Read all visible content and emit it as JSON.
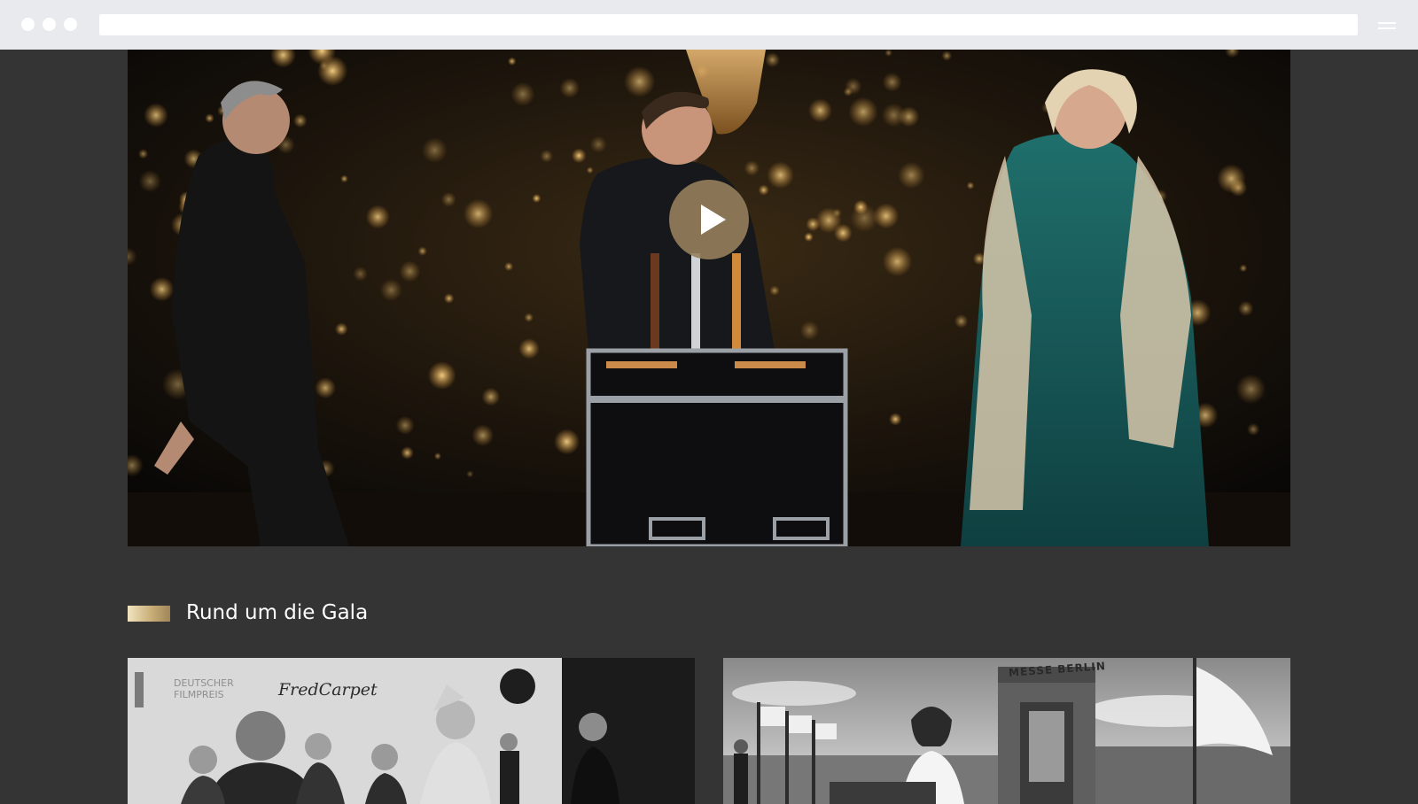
{
  "browser": {
    "window_controls": [
      "close-dot",
      "minimize-dot",
      "maximize-dot"
    ],
    "menu_icon": "hamburger-menu-icon"
  },
  "hero": {
    "play_icon": "play-icon",
    "play_button_color": "#96805c"
  },
  "section": {
    "title": "Rund um die Gala",
    "accent_color": "#c9ae78"
  },
  "thumbnails": [
    {
      "watermark_line1": "DEUTSCHER",
      "watermark_line2": "FILMPREIS",
      "sponsor": "FredCarpet"
    },
    {
      "sign": "MESSE BERLIN"
    }
  ]
}
